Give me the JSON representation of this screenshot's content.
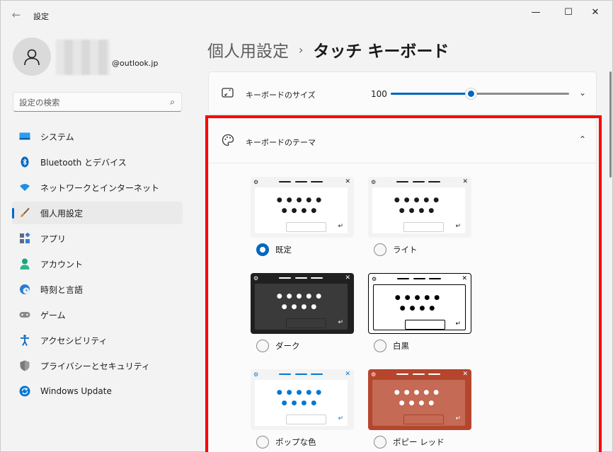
{
  "window": {
    "app_title": "設定",
    "back_glyph": "←",
    "minimize_glyph": "—",
    "maximize_glyph": "☐",
    "close_glyph": "✕"
  },
  "user": {
    "email": "@outlook.jp"
  },
  "search": {
    "placeholder": "設定の検索"
  },
  "sidebar": {
    "items": [
      {
        "label": "システム",
        "icon": "system-icon",
        "color": "#0078d4",
        "active": false
      },
      {
        "label": "Bluetooth とデバイス",
        "icon": "bluetooth-icon",
        "color": "#0067c0",
        "active": false
      },
      {
        "label": "ネットワークとインターネット",
        "icon": "network-icon",
        "color": "#0f7ee0",
        "active": false
      },
      {
        "label": "個人用設定",
        "icon": "brush-icon",
        "color": "#e2893a",
        "active": true
      },
      {
        "label": "アプリ",
        "icon": "apps-icon",
        "color": "#4a6fa5",
        "active": false
      },
      {
        "label": "アカウント",
        "icon": "account-icon",
        "color": "#1aa37a",
        "active": false
      },
      {
        "label": "時刻と言語",
        "icon": "clock-globe-icon",
        "color": "#2a7bd1",
        "active": false
      },
      {
        "label": "ゲーム",
        "icon": "gamepad-icon",
        "color": "#7a7a7a",
        "active": false
      },
      {
        "label": "アクセシビリティ",
        "icon": "accessibility-icon",
        "color": "#0067c0",
        "active": false
      },
      {
        "label": "プライバシーとセキュリティ",
        "icon": "shield-icon",
        "color": "#6b6b6b",
        "active": false
      },
      {
        "label": "Windows Update",
        "icon": "update-icon",
        "color": "#0078d4",
        "active": false
      }
    ]
  },
  "breadcrumb": {
    "parent": "個人用設定",
    "separator": "›",
    "current": "タッチ キーボード"
  },
  "keyboard_size": {
    "label": "キーボードのサイズ",
    "value": "100",
    "slider_fraction": 0.45
  },
  "keyboard_theme": {
    "label": "キーボードのテーマ",
    "themes": [
      {
        "label": "既定",
        "checked": true,
        "frame": "#f3f3f3",
        "body": "#ffffff",
        "key": "#1b1b1b",
        "dash": "#1b1b1b",
        "space_border": "#cfcfcf",
        "space_fill": "#ffffff",
        "outline": "none"
      },
      {
        "label": "ライト",
        "checked": false,
        "frame": "#f3f3f3",
        "body": "#ffffff",
        "key": "#1b1b1b",
        "dash": "#1b1b1b",
        "space_border": "#cfcfcf",
        "space_fill": "#ffffff",
        "outline": "none"
      },
      {
        "label": "ダーク",
        "checked": false,
        "frame": "#202020",
        "body": "#3a3a3a",
        "key": "#ffffff",
        "dash": "#ffffff",
        "space_border": "#2a2a2a",
        "space_fill": "#3a3a3a",
        "outline": "none"
      },
      {
        "label": "白黒",
        "checked": false,
        "frame": "#ffffff",
        "body": "#ffffff",
        "key": "#000000",
        "dash": "#000000",
        "space_border": "#000000",
        "space_fill": "#ffffff",
        "outline": "#000000"
      },
      {
        "label": "ポップな色",
        "checked": false,
        "frame": "#f3f3f3",
        "body": "#ffffff",
        "key": "#0078d4",
        "dash": "#0078d4",
        "space_border": "#cfcfcf",
        "space_fill": "#ffffff",
        "outline": "none"
      },
      {
        "label": "ポピー レッド",
        "checked": false,
        "frame": "#b5462d",
        "body": "#c46a55",
        "key": "#ffffff",
        "dash": "#ffffff",
        "space_border": "#a84530",
        "space_fill": "#c46a55",
        "outline": "none"
      }
    ]
  }
}
